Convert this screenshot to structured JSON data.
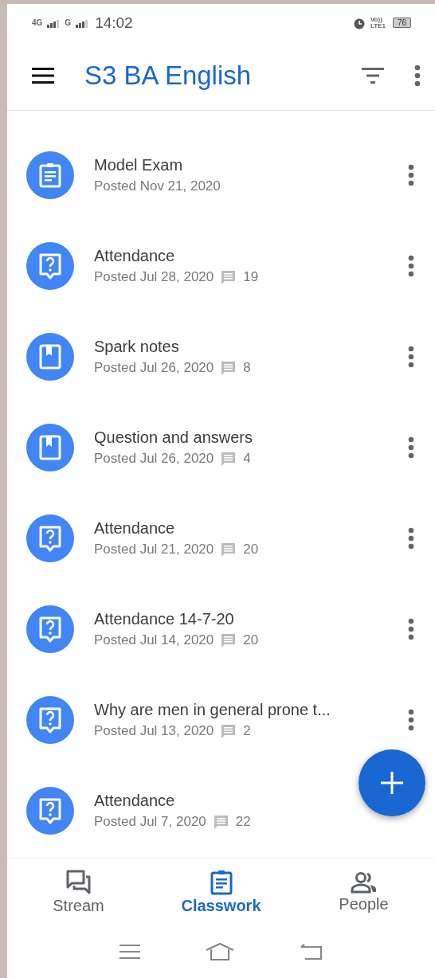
{
  "status_bar": {
    "network_1": "4G",
    "network_2": "G",
    "time": "14:02",
    "volte": "Vo)) LTE1",
    "battery": "76"
  },
  "app_bar": {
    "title": "S3 BA English"
  },
  "items": [
    {
      "kind": "assignment",
      "title": "Model Exam",
      "posted": "Posted Nov 21, 2020"
    },
    {
      "kind": "question",
      "title": "Attendance",
      "posted": "Posted Jul 28, 2020",
      "comments": "19"
    },
    {
      "kind": "material",
      "title": "Spark notes",
      "posted": "Posted Jul 26, 2020",
      "comments": "8"
    },
    {
      "kind": "material",
      "title": "Question and answers",
      "posted": "Posted Jul 26, 2020",
      "comments": "4"
    },
    {
      "kind": "question",
      "title": "Attendance",
      "posted": "Posted Jul 21, 2020",
      "comments": "20"
    },
    {
      "kind": "question",
      "title": "Attendance 14-7-20",
      "posted": "Posted Jul 14, 2020",
      "comments": "20"
    },
    {
      "kind": "question",
      "title": "Why are men in general prone t...",
      "posted": "Posted Jul 13, 2020",
      "comments": "2"
    },
    {
      "kind": "question",
      "title": "Attendance",
      "posted": "Posted Jul 7, 2020",
      "comments": "22",
      "menu": false
    }
  ],
  "bottom_nav": [
    {
      "kind": "stream",
      "label": "Stream",
      "selected": false
    },
    {
      "kind": "classwork",
      "label": "Classwork",
      "selected": true
    },
    {
      "kind": "people",
      "label": "People",
      "selected": false
    }
  ]
}
